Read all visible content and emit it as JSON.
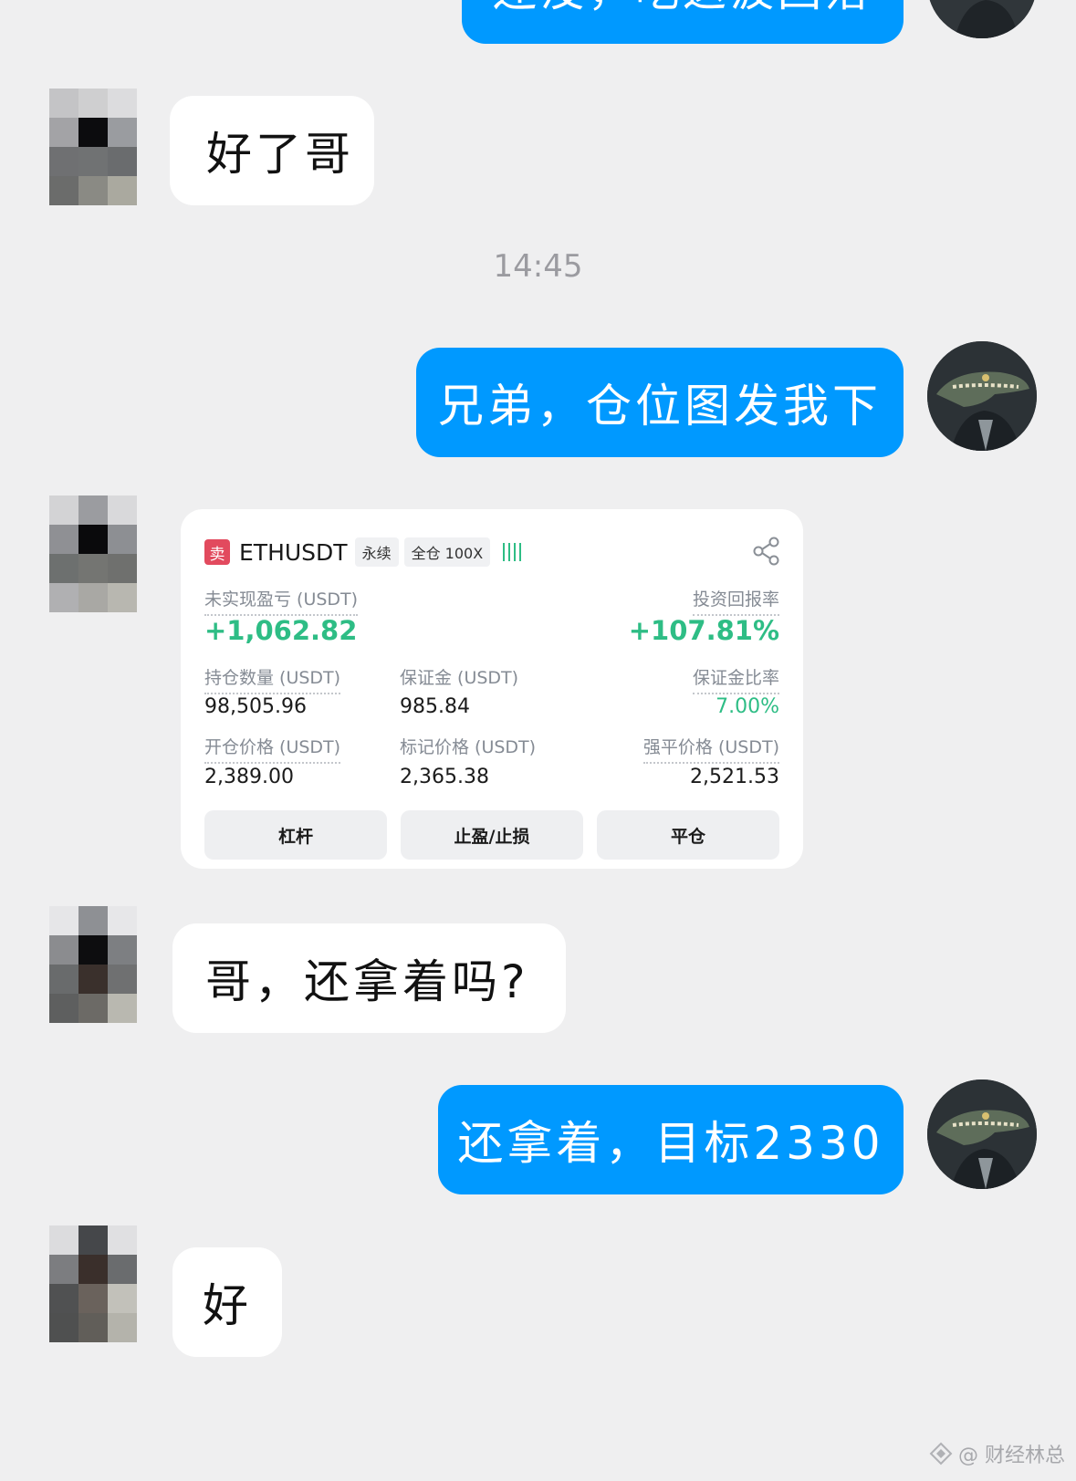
{
  "chat": {
    "timestamp": "14:45",
    "messages": [
      {
        "from": "self",
        "text": "还没，吃这波回落"
      },
      {
        "from": "other",
        "text": "好了哥"
      },
      {
        "from": "self",
        "text": "兄弟，仓位图发我下"
      },
      {
        "from": "other",
        "text": "哥，还拿着吗?"
      },
      {
        "from": "self",
        "text": "还拿着，目标2330"
      },
      {
        "from": "other",
        "text": "好"
      }
    ]
  },
  "position_card": {
    "side_badge": "卖",
    "symbol": "ETHUSDT",
    "contract_type": "永续",
    "margin_mode": "全仓 100X",
    "unrealized_pnl_label": "未实现盈亏 (USDT)",
    "unrealized_pnl_value": "+1,062.82",
    "roi_label": "投资回报率",
    "roi_value": "+107.81%",
    "position_size_label": "持仓数量 (USDT)",
    "position_size_value": "98,505.96",
    "margin_label": "保证金 (USDT)",
    "margin_value": "985.84",
    "margin_ratio_label": "保证金比率",
    "margin_ratio_value": "7.00%",
    "entry_price_label": "开仓价格 (USDT)",
    "entry_price_value": "2,389.00",
    "mark_price_label": "标记价格 (USDT)",
    "mark_price_value": "2,365.38",
    "liq_price_label": "强平价格 (USDT)",
    "liq_price_value": "2,521.53",
    "buttons": [
      "杠杆",
      "止盈/止损",
      "平仓"
    ],
    "share_icon": "share-icon",
    "signal_icon": "signal-bars-icon"
  },
  "watermark": {
    "text": "@ 财经林总"
  },
  "colors": {
    "outgoing_bubble": "#0099ff",
    "incoming_bubble": "#ffffff",
    "background": "#efeff0",
    "profit_green": "#2ebd85",
    "sell_red": "#e24a5e"
  }
}
